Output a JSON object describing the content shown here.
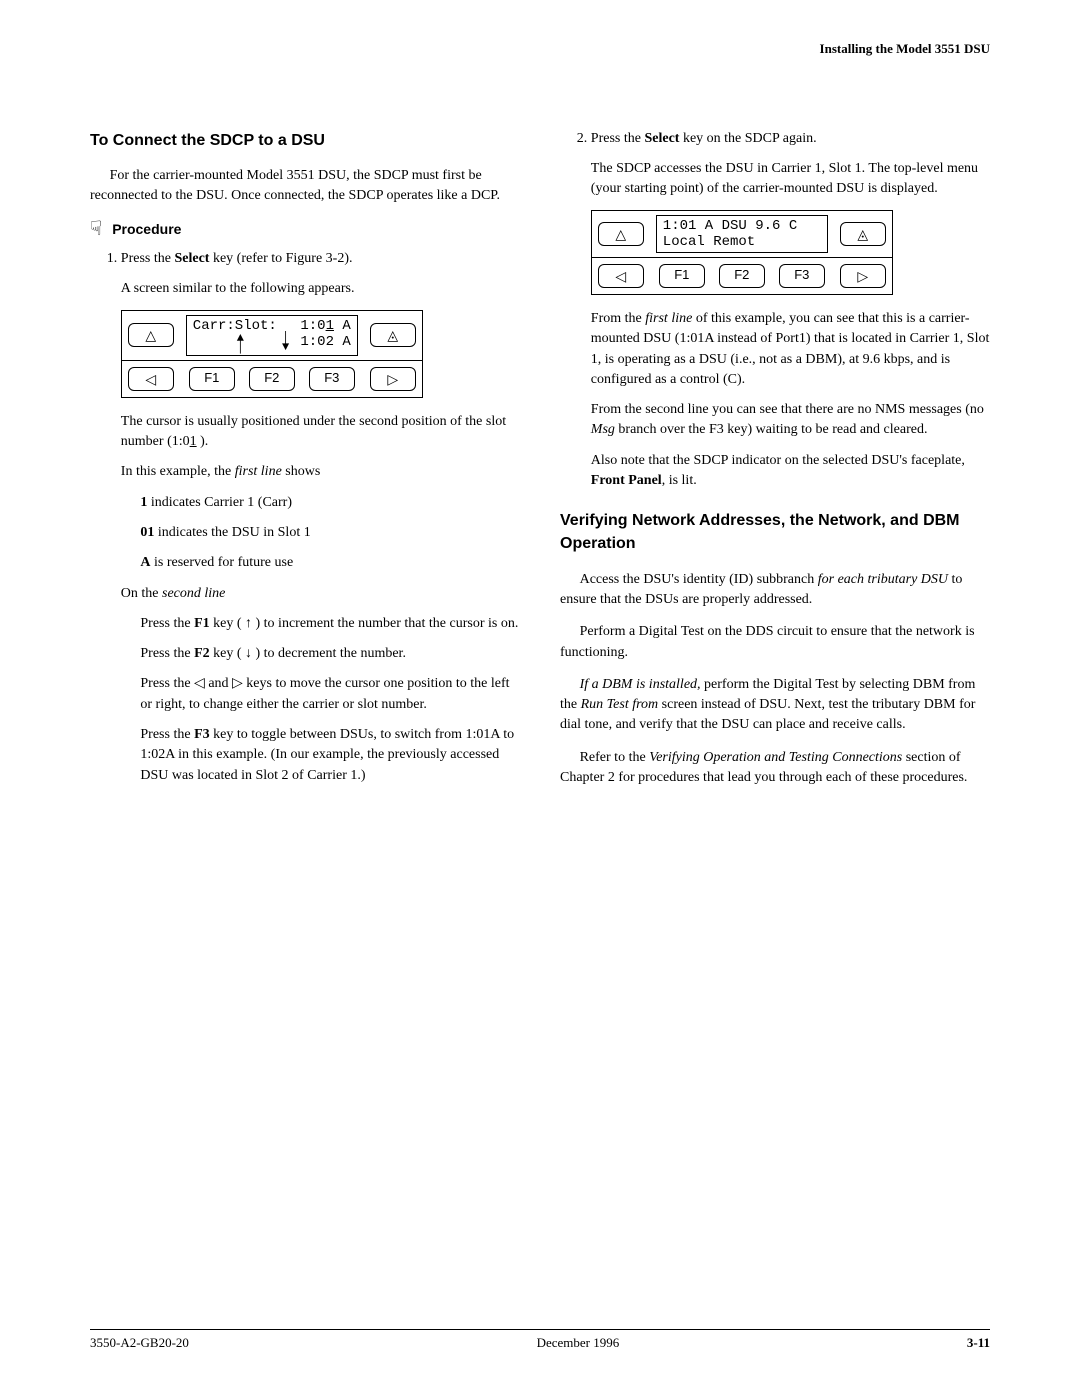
{
  "running_head": "Installing the Model 3551 DSU",
  "left": {
    "heading": "To Connect the SDCP to a DSU",
    "intro": "For the carrier-mounted Model 3551 DSU, the SDCP must first be reconnected to the DSU. Once connected, the SDCP operates like a DCP.",
    "procedure_label": "Procedure",
    "step1_a": "Press the ",
    "step1_bold": "Select",
    "step1_b": " key (refer to Figure 3-2).",
    "step1_after": "A screen similar to the following appears.",
    "lcd1": {
      "line1_left": "Carr:Slot:",
      "line1_right": "1:01 A",
      "line2_right": "1:02 A",
      "f1": "F1",
      "f2": "F2",
      "f3": "F3"
    },
    "cursor_p_a": "The cursor is usually positioned under the second position of the slot number (1:0",
    "cursor_p_u": "1",
    "cursor_p_b": " ).",
    "example_intro_a": "In this example, the ",
    "example_intro_i": "first line",
    "example_intro_b": " shows",
    "bullet1_b": "1",
    "bullet1_t": " indicates Carrier 1 (Carr)",
    "bullet2_b": "01",
    "bullet2_t": " indicates the DSU in Slot 1",
    "bullet3_b": "A",
    "bullet3_t": " is reserved for future use",
    "second_line_a": "On the ",
    "second_line_i": "second line",
    "pf1_a": "Press the ",
    "pf1_b": "F1",
    "pf1_c": " key ( ↑ ) to increment the number that the cursor is on.",
    "pf2_a": "Press the ",
    "pf2_b": "F2",
    "pf2_c": " key ( ↓ ) to decrement the number.",
    "pnav": "Press the  ◁  and  ▷  keys to move the cursor one position to the left or right, to change either the carrier or slot number.",
    "pf3_a": "Press the ",
    "pf3_b": "F3",
    "pf3_c": " key to toggle between DSUs, to switch from 1:01A to 1:02A in this example. (In our example, the previously accessed DSU was located in Slot 2 of Carrier 1.)"
  },
  "right": {
    "step2_a": "Press the ",
    "step2_bold": "Select",
    "step2_b": " key on the SDCP again.",
    "step2_after": "The SDCP accesses the DSU in Carrier 1, Slot 1. The top-level menu (your starting point) of the carrier-mounted DSU is displayed.",
    "lcd2": {
      "line1": "1:01 A   DSU     9.6 C",
      "line2": "Local   Remot",
      "f1": "F1",
      "f2": "F2",
      "f3": "F3"
    },
    "p1_a": "From the ",
    "p1_i": "first line",
    "p1_b": " of this example, you can see that this is a carrier-mounted DSU (1:01A instead of Port1) that is located in Carrier 1, Slot 1, is operating as a DSU (i.e., not as a DBM), at 9.6 kbps, and is configured as a control (C).",
    "p2_a": "From the second line you can see that there are no NMS messages (no ",
    "p2_i": "Msg",
    "p2_b": " branch over the F3 key) waiting to be read and cleared.",
    "p3_a": "Also note that the SDCP indicator on the selected DSU's faceplate, ",
    "p3_bold": "Front Panel",
    "p3_b": ", is lit.",
    "heading2": "Verifying Network Addresses, the Network, and DBM Operation",
    "v1_a": "Access the DSU's identity (ID) subbranch ",
    "v1_i": "for each tributary DSU",
    "v1_b": " to ensure that the DSUs are properly addressed.",
    "v2": "Perform a Digital Test on the DDS circuit to ensure that the network is functioning.",
    "v3_i": "If a DBM is installed,",
    "v3_a": " perform the Digital Test by selecting DBM from the ",
    "v3_i2": "Run Test from",
    "v3_b": " screen instead of DSU. Next, test the tributary DBM for dial tone, and verify that the DSU can place and receive calls.",
    "v4_a": "Refer to the ",
    "v4_i": "Verifying Operation and Testing Connections",
    "v4_b": " section of Chapter 2 for procedures that lead you through each of these procedures."
  },
  "footer": {
    "doc": "3550-A2-GB20-20",
    "date": "December 1996",
    "page": "3-11"
  },
  "icons": {
    "tri_up": "△",
    "tri_menu": "◬",
    "tri_left": "◁",
    "tri_right": "▷",
    "hand": "☟"
  }
}
